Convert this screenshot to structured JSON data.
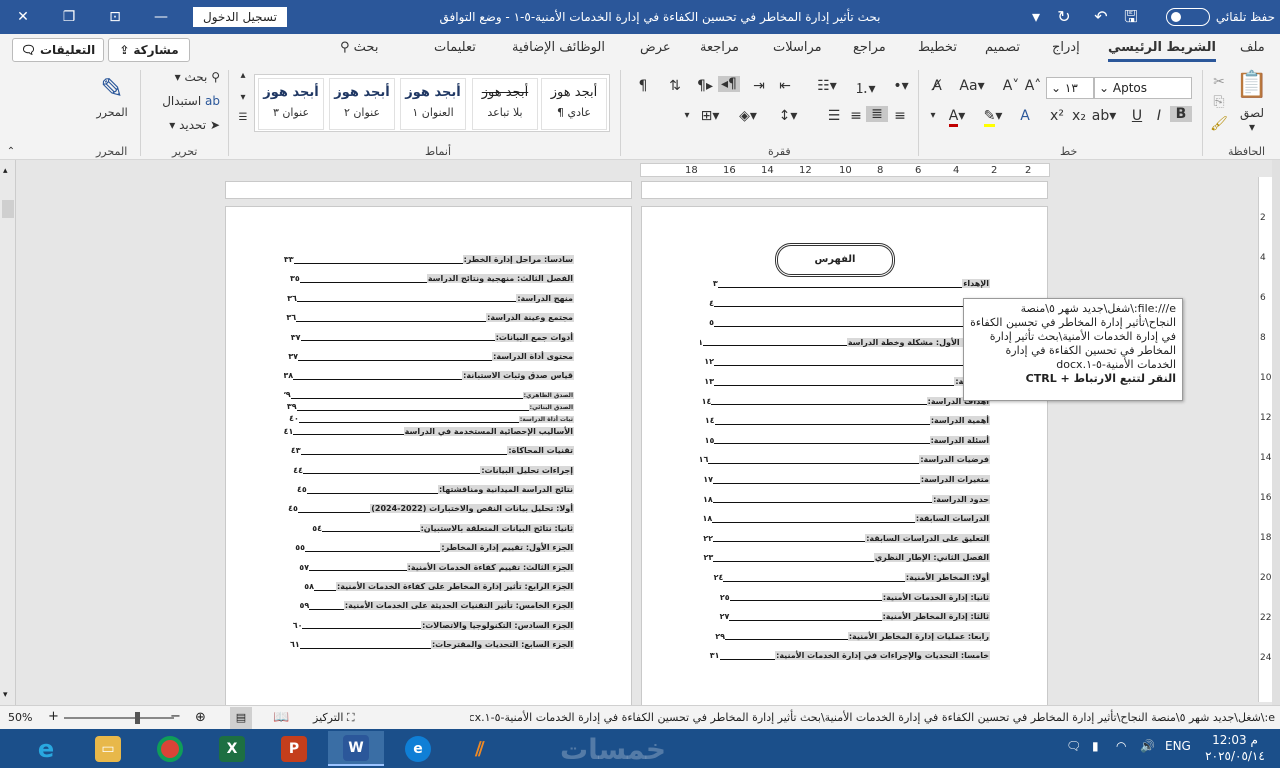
{
  "window": {
    "title": "بحث تأثير إدارة المخاطر في تحسين الكفاءة في إدارة الخدمات الأمنية-٥-١  -  وضع التوافق",
    "signin_label": "تسجيل الدخول",
    "autosave_label": "حفظ تلقائي"
  },
  "tabs": [
    {
      "label": "ملف"
    },
    {
      "label": "الشريط الرئيسي"
    },
    {
      "label": "إدراج"
    },
    {
      "label": "تصميم"
    },
    {
      "label": "تخطيط"
    },
    {
      "label": "مراجع"
    },
    {
      "label": "مراسلات"
    },
    {
      "label": "مراجعة"
    },
    {
      "label": "عرض"
    },
    {
      "label": "الوظائف الإضافية"
    },
    {
      "label": "تعليمات"
    },
    {
      "label": "بحث"
    }
  ],
  "header_buttons": {
    "share": "مشاركة",
    "comments": "التعليقات"
  },
  "ribbon": {
    "groups": {
      "clipboard": "الحافظة",
      "font": "خط",
      "paragraph": "فقرة",
      "styles": "أنماط",
      "editing": "تحرير",
      "editor": "المحرر"
    },
    "paste_label": "لصق",
    "font_name": "Aptos",
    "font_size": "١٣",
    "find_label": "بحث",
    "replace_label": "استبدال",
    "select_label": "تحديد",
    "editor_label": "المحرر",
    "styles": [
      {
        "sample": "أبجد هوز",
        "name": "¶ عادي"
      },
      {
        "sample": "أبجد هوز",
        "name": "بلا تباعد"
      },
      {
        "sample": "أبجد هوز",
        "name": "العنوان ١"
      },
      {
        "sample": "أبجد هوز",
        "name": "عنوان ٢"
      },
      {
        "sample": "أبجد هوز",
        "name": "عنوان ٣"
      }
    ]
  },
  "ruler_numbers": [
    "2",
    "2",
    "4",
    "6",
    "8",
    "10",
    "12",
    "14",
    "16",
    "18"
  ],
  "vruler_numbers": [
    "2",
    "4",
    "6",
    "8",
    "10",
    "12",
    "14",
    "16",
    "18",
    "20",
    "22",
    "24"
  ],
  "right_page": {
    "toc_title": "الفهرس",
    "lines": [
      {
        "title": "الإهداء",
        "page": "٣"
      },
      {
        "title": "",
        "page": "٤"
      },
      {
        "title": "",
        "page": "٥"
      },
      {
        "title": "الفصل الأول: مشكلة وخطة الدراسة",
        "page": "١١"
      },
      {
        "title": "",
        "page": "١٢"
      },
      {
        "title": "الدراسة:",
        "page": "١٣"
      },
      {
        "title": "أهداف الدراسة:",
        "page": "١٤"
      },
      {
        "title": "أهمية الدراسة:",
        "page": "١٤"
      },
      {
        "title": "أسئلة الدراسة:",
        "page": "١٥"
      },
      {
        "title": "فرضيات الدراسة:",
        "page": "١٦"
      },
      {
        "title": "متغيرات الدراسة:",
        "page": "١٧"
      },
      {
        "title": "حدود الدراسة:",
        "page": "١٨"
      },
      {
        "title": "الدراسات السابقة:",
        "page": "١٨"
      },
      {
        "title": "التعليق على الدراسات السابقة:",
        "page": "٢٢"
      },
      {
        "title": "الفصل الثاني: الإطار النظري",
        "page": "٢٣"
      },
      {
        "title": "أولا: المخاطر الأمنية:",
        "page": "٢٤"
      },
      {
        "title": "ثانيا: إدارة الخدمات الأمنية:",
        "page": "٢٥"
      },
      {
        "title": "ثالثا: إدارة المخاطر الأمنية:",
        "page": "٢٧"
      },
      {
        "title": "رابعا: عمليات إدارة المخاطر الأمنية:",
        "page": "٢٩"
      },
      {
        "title": "خامسا: التحديات والإجراءات في إدارة الخدمات الأمنية:",
        "page": "٣١"
      }
    ]
  },
  "left_page": {
    "lines": [
      {
        "title": "سادسا: مراحل إدارة الخطر:",
        "page": "٣٣"
      },
      {
        "title": "الفصل الثالث: منهجية ونتائج الدراسة",
        "page": "٣٥"
      },
      {
        "title": "منهج الدراسة:",
        "page": "٣٦"
      },
      {
        "title": "مجتمع وعينة الدراسة:",
        "page": "٣٦"
      },
      {
        "title": "أدوات جمع البيانات:",
        "page": "٣٧"
      },
      {
        "title": "محتوى أداة الدراسة:",
        "page": "٣٧"
      },
      {
        "title": "قياس صدق وثبات الاستبانة:",
        "page": "٣٨"
      },
      {
        "title": "الصدق الظاهري:",
        "page": "٣٩",
        "small": true
      },
      {
        "title": "الصدق البنائي:",
        "page": "٣٩",
        "small": true
      },
      {
        "title": "ثبات أداة الدراسة:",
        "page": "٤٠",
        "small": true
      },
      {
        "title": "الأساليب الإحصائية المستخدمة في الدراسة",
        "page": "٤١"
      },
      {
        "title": "تقنيات المحاكاة:",
        "page": "٤٣"
      },
      {
        "title": "إجراءات تحليل البيانات:",
        "page": "٤٤"
      },
      {
        "title": "نتائج الدراسة الميدانية ومناقشتها:",
        "page": "٤٥"
      },
      {
        "title": "أولا: تحليل بيانات النقص والاختبارات (2022-2024)",
        "page": "٤٥"
      },
      {
        "title": "ثانيا: نتائج البيانات المتعلقة بالاستبيان:",
        "page": "٥٤"
      },
      {
        "title": "الجزء الأول: تقييم إدارة المخاطر:",
        "page": "٥٥"
      },
      {
        "title": "الجزء الثالث: تقييم كفاءة الخدمات الأمنية:",
        "page": "٥٧"
      },
      {
        "title": "الجزء الرابع: تأثير إدارة المخاطر على كفاءة الخدمات الأمنية:",
        "page": "٥٨"
      },
      {
        "title": "الجزء الخامس: تأثير التقنيات الحديثة على الخدمات الأمنية:",
        "page": "٥٩"
      },
      {
        "title": "الجزء السادس: التكنولوجيا والاتصالات:",
        "page": "٦٠"
      },
      {
        "title": "الجزء السابع: التحديات والمقترحات:",
        "page": "٦١"
      }
    ]
  },
  "tooltip": {
    "path": "file:///e:\\شغل\\جديد شهر ٥\\منصة النجاح\\تأثير إدارة المخاطر في تحسين الكفاءة في إدارة الخدمات الأمنية\\بحث تأثير إدارة المخاطر في تحسين الكفاءة في إدارة الخدمات الأمنية-٥-١.docx",
    "hint": "النقر لتتبع الارتباط + CTRL"
  },
  "statusbar": {
    "path": "e:\\شغل\\جديد شهر ٥\\منصة النجاح\\تأثير إدارة المخاطر في تحسين الكفاءة في إدارة الخدمات الأمنية\\بحث تأثير إدارة المخاطر في تحسين الكفاءة في إدارة الخدمات الأمنية-٥-١.docx",
    "focus_label": "التركيز",
    "zoom": "50%"
  },
  "taskbar": {
    "language": "ENG",
    "time": "12:03 م",
    "date": "٢٠٢٥/٠٥/١٤",
    "watermark": "خمسات"
  },
  "colors": {
    "titlebar": "#2b579a",
    "taskbar": "#1b4f8a",
    "excel": "#1d6f42",
    "powerpoint": "#c43e1c",
    "word": "#2b579a"
  }
}
